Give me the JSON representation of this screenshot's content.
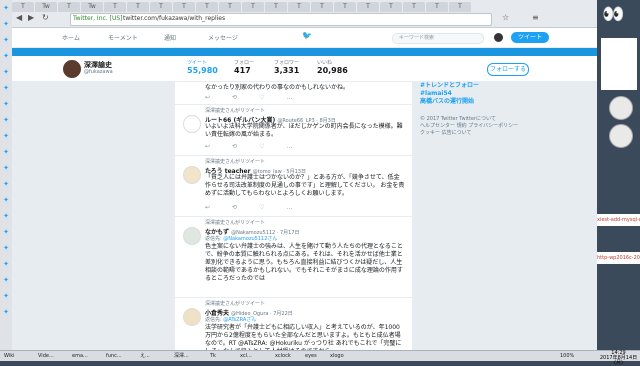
{
  "browser": {
    "site_identity": "Twitter, Inc. [US]",
    "url": "twitter.com/fukazawa/with_replies",
    "tabs": [
      "T",
      "Tw",
      "T",
      "Tw",
      "T",
      "T",
      "T",
      "T",
      "T",
      "T",
      "T",
      "T",
      "T",
      "T",
      "T",
      "T",
      "T",
      "T",
      "T",
      "T"
    ]
  },
  "header": {
    "nav": [
      "ホーム",
      "モーメント",
      "通知",
      "メッセージ"
    ],
    "search_placeholder": "キーワード検索",
    "tweet_button": "ツイート"
  },
  "profile": {
    "name": "深澤諭史",
    "handle": "@fukazawa",
    "stats": [
      {
        "label": "ツイート",
        "value": "55,980"
      },
      {
        "label": "フォロー",
        "value": "417"
      },
      {
        "label": "フォロワー",
        "value": "3,331"
      },
      {
        "label": "いいね",
        "value": "20,986"
      }
    ],
    "follow_button": "フォローする"
  },
  "tweets": [
    {
      "rt": "",
      "author": "",
      "handle": "",
      "reply_to": "",
      "text": "なかったり別家の代わりの事なのかもしれないかね。"
    },
    {
      "rt": "深澤諭史さんがリツイート",
      "author": "ルート66 (ギルバン大賞)",
      "handle": "@Route66_LP3 · 8月3日",
      "reply_to": "",
      "text": "いよいよ法科大学院関係者が、ほだしかゲンの町内会長になった模様。難い責任転嫁の風が始まる。"
    },
    {
      "rt": "深澤諭史さんがリツイート",
      "author": "たろう teacher",
      "handle": "@tomo_law · 5月13日",
      "reply_to": "",
      "text": "「貧乏人には弁護士はつかないのか？」とある方が、「競争させて、低金作らせる司法改革制度の見通しの事です」と理解してください。 お金を貴めずに活動してもらわないとよろしくお願いします。"
    },
    {
      "rt": "深澤諭史さんがリツイート",
      "author": "なかもず",
      "handle": "@Nakamozu5112 · 7月17日",
      "reply_to": "@Nakamozu5112さん",
      "text": "色主案にない弁護士の強みは、人生を賭けて動う人たちの代理となることで、紛争の本質に触れられる点にある。それは、それを活かせば他士業と差別化できるように思う。もちろん直接利益に結びつくかは疑だし、人生相談の範疇であるかもしれない。でもそれこそがまさに成な理論の作用するところだったのでは"
    },
    {
      "rt": "深澤諭史さんがリツイート",
      "author": "小倉秀夫",
      "handle": "@Hideo_Ogura · 7月22日",
      "reply_to": "@ATsZRAさん",
      "text": "法学研究者が「弁護士どもに相応しい収入」と考えているのが、年1000万円から2億程度をもらいた全部なんだと思いますよ。もともと成仏者場なので。RT @ATsZRA: @Hokuriku がっつり社 あれでもこれで「完璧にしま」なんで収入として人材受けるのですから"
    }
  ],
  "tweet_actions": [
    "↩",
    "⟲",
    "♡",
    "…"
  ],
  "sidebar_right": {
    "trends": [
      "#トレンドとフォロー",
      "#lamai54",
      "高橋バスの運行開始",
      "トレンド"
    ],
    "footer": [
      "© 2017 Twitter",
      "Twitterについて",
      "ヘルプセンター",
      "規約",
      "プライバシーポリシー",
      "クッキー",
      "広告について"
    ]
  },
  "desktop": {
    "notes": [
      "xiest-add-mysql-utlity.sh",
      "http-wp2016c-2016100"
    ],
    "clock": "14:29",
    "date": "2017年8月14日(月)"
  },
  "taskbar": {
    "items": [
      "Wiki",
      "Vide...",
      "ema...",
      "func...",
      "え...",
      "深澤...",
      "Tk",
      "xcl...",
      "xclock",
      "eyes",
      "xlogo"
    ],
    "volume": "100%"
  },
  "colors": {
    "accent": "#1da1f2",
    "banner": "#1b95e0"
  }
}
